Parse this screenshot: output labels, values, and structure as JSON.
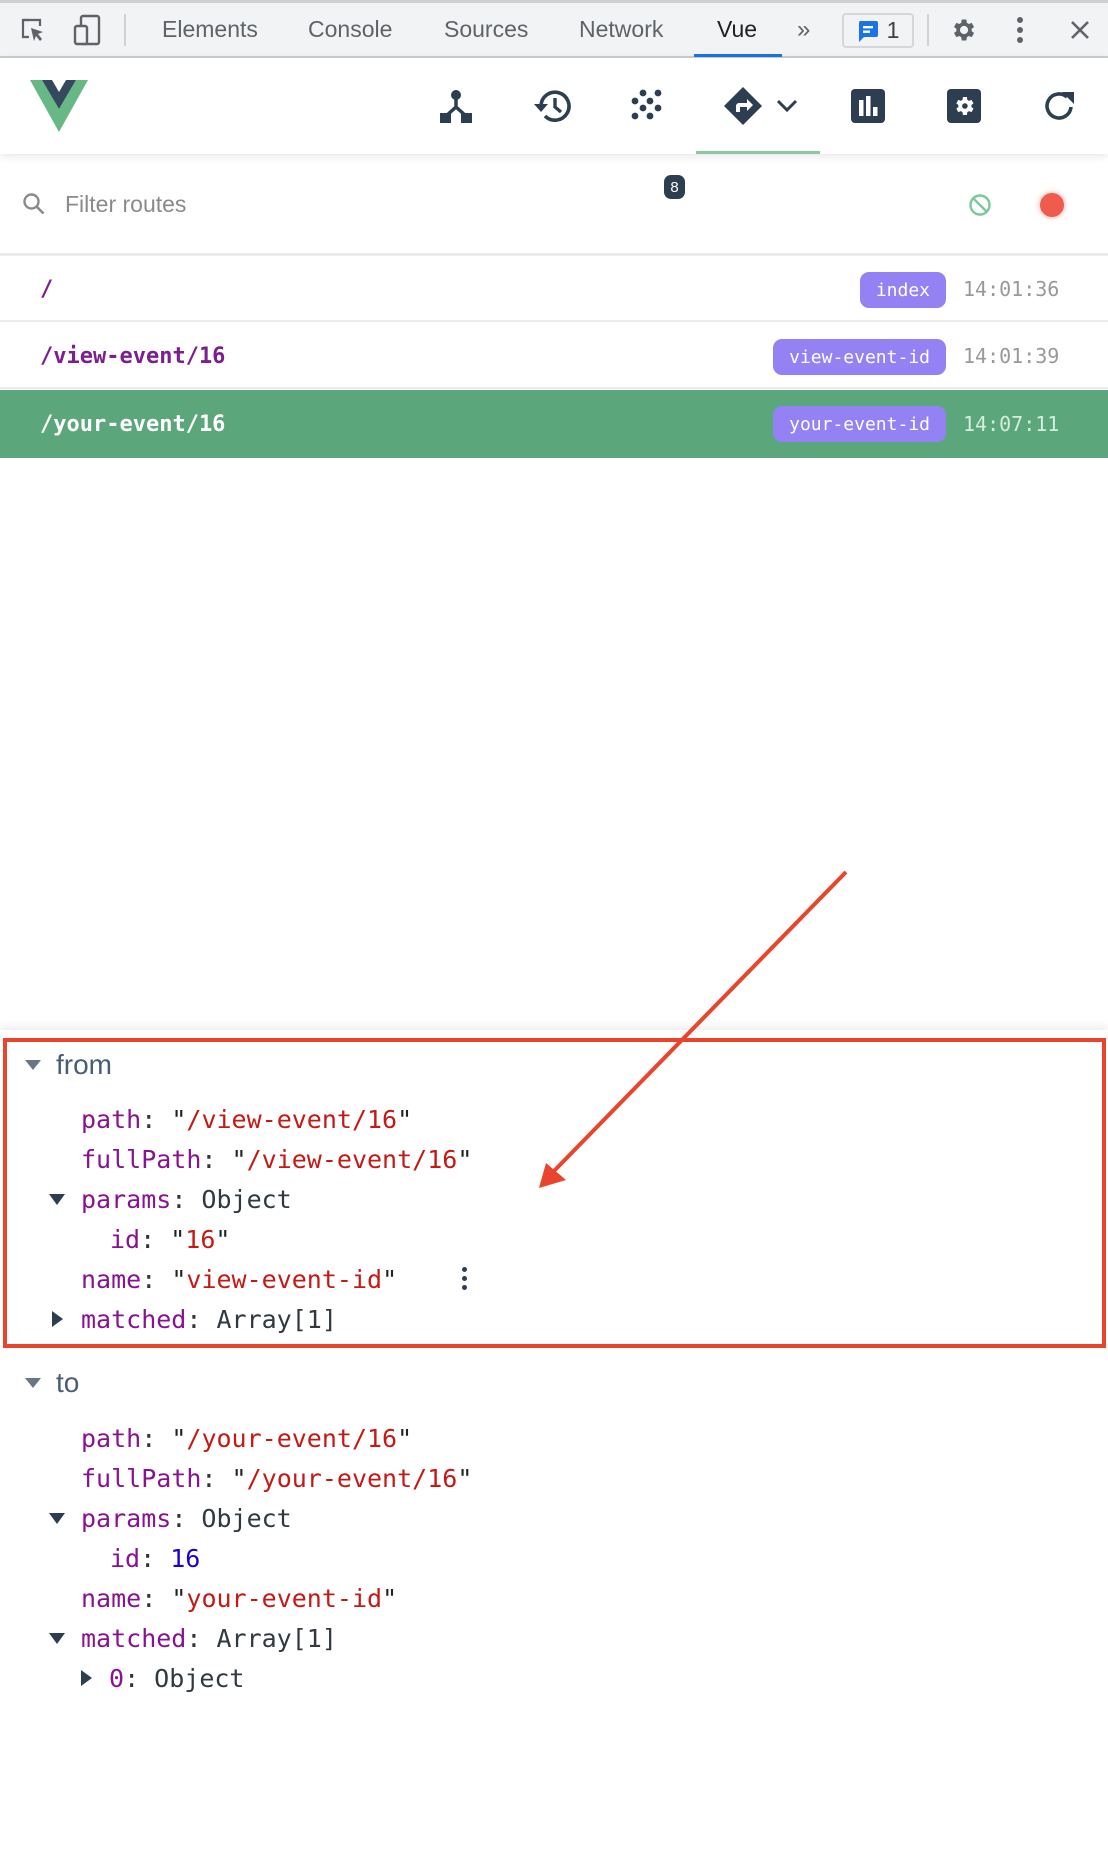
{
  "devtools": {
    "tabs": [
      {
        "label": "Elements",
        "active": false
      },
      {
        "label": "Console",
        "active": false
      },
      {
        "label": "Sources",
        "active": false
      },
      {
        "label": "Network",
        "active": false
      },
      {
        "label": "Vue",
        "active": true
      }
    ],
    "more_tabs_glyph": "»",
    "issues_count": "1",
    "icons": {
      "inspect": "inspect-element-icon",
      "device": "device-toolbar-icon",
      "issues": "issues-message-icon",
      "settings": "gear-icon",
      "menu": "kebab-menu-icon",
      "close": "close-icon"
    }
  },
  "vue_toolbar": {
    "logo": "vue-logo",
    "items": [
      {
        "name": "components",
        "icon": "component-tree-icon"
      },
      {
        "name": "timeline",
        "icon": "history-icon"
      },
      {
        "name": "vuex",
        "icon": "vuex-dots-icon",
        "badge": "8"
      },
      {
        "name": "routing",
        "icon": "router-sign-icon",
        "active": true,
        "dropdown": true
      },
      {
        "name": "performance",
        "icon": "bar-chart-icon"
      },
      {
        "name": "settings",
        "icon": "settings-icon"
      },
      {
        "name": "refresh",
        "icon": "refresh-icon"
      }
    ],
    "accent_color": "#42b883"
  },
  "filter": {
    "placeholder": "Filter routes",
    "value": ""
  },
  "routes": [
    {
      "path": "/",
      "name": "index",
      "time": "14:01:36",
      "selected": false
    },
    {
      "path": "/view-event/16",
      "name": "view-event-id",
      "time": "14:01:39",
      "selected": false
    },
    {
      "path": "/your-event/16",
      "name": "your-event-id",
      "time": "14:07:11",
      "selected": true
    }
  ],
  "inspector": {
    "from": {
      "label": "from",
      "path": "/view-event/16",
      "fullPath": "/view-event/16",
      "params_type": "Object",
      "params_id": "16",
      "params_id_type": "string",
      "name": "view-event-id",
      "matched_type": "Array[1]",
      "matched_expanded": false
    },
    "to": {
      "label": "to",
      "path": "/your-event/16",
      "fullPath": "/your-event/16",
      "params_type": "Object",
      "params_id": "16",
      "params_id_type": "number",
      "name": "your-event-id",
      "matched_type": "Array[1]",
      "matched_expanded": true,
      "matched_items": [
        {
          "index": "0",
          "type": "Object"
        }
      ]
    }
  },
  "keys": {
    "path": "path",
    "fullPath": "fullPath",
    "params": "params",
    "id": "id",
    "name": "name",
    "matched": "matched"
  },
  "annotation": {
    "color": "#e8452c",
    "highlights": "from"
  }
}
